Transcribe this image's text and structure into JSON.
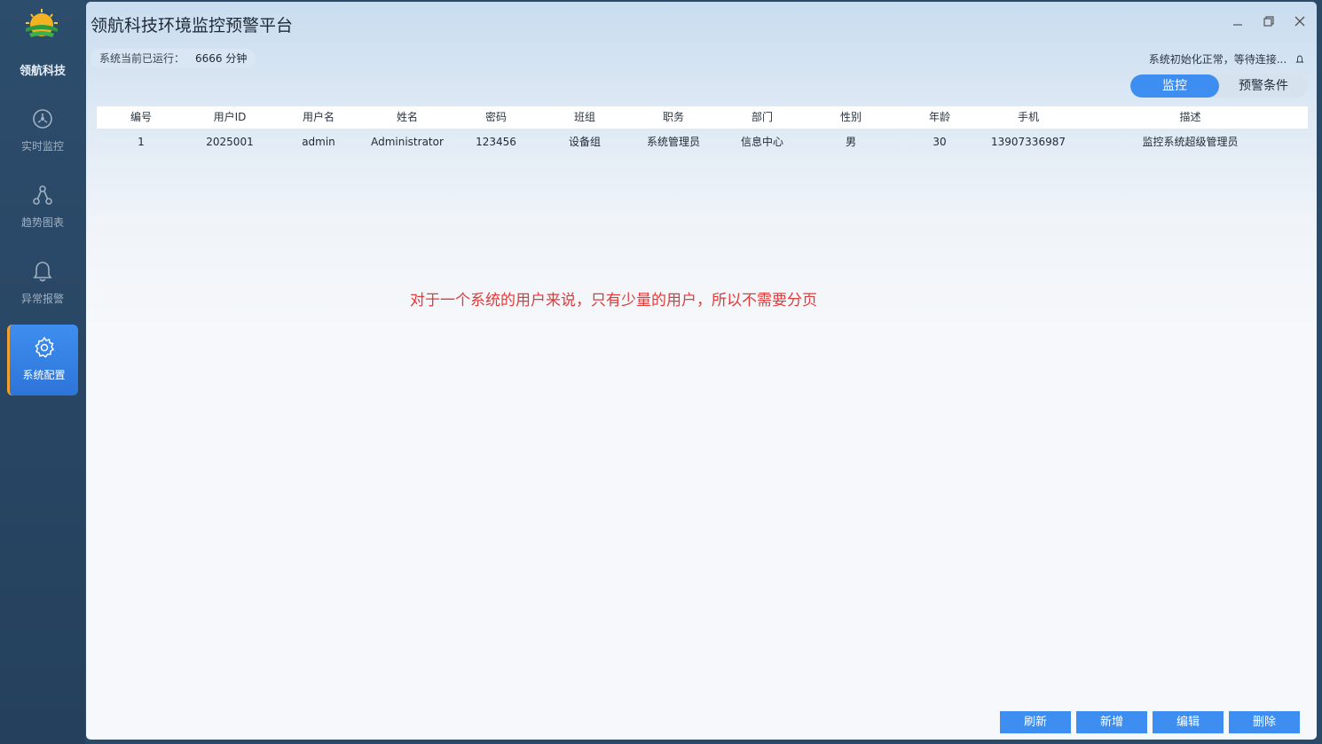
{
  "sidebar": {
    "brand": "领航科技",
    "items": [
      {
        "label": "实时监控",
        "icon": "monitor-icon"
      },
      {
        "label": "趋势图表",
        "icon": "chart-nodes-icon"
      },
      {
        "label": "异常报警",
        "icon": "bell-icon"
      },
      {
        "label": "系统配置",
        "icon": "gear-icon",
        "active": true
      }
    ]
  },
  "window": {
    "title": "领航科技环境监控预警平台"
  },
  "runtime": {
    "label": "系统当前已运行：",
    "value": "6666 分钟"
  },
  "status": {
    "text": "系统初始化正常，等待连接..."
  },
  "tabs": [
    {
      "label": "监控",
      "active": true
    },
    {
      "label": "预警条件",
      "active": false
    }
  ],
  "table": {
    "headers": [
      "编号",
      "用户ID",
      "用户名",
      "姓名",
      "密码",
      "班组",
      "职务",
      "部门",
      "性别",
      "年龄",
      "手机",
      "描述"
    ],
    "rows": [
      [
        "1",
        "2025001",
        "admin",
        "Administrator",
        "123456",
        "设备组",
        "系统管理员",
        "信息中心",
        "男",
        "30",
        "13907336987",
        "监控系统超级管理员"
      ]
    ]
  },
  "note": "对于一个系统的用户来说，只有少量的用户，所以不需要分页",
  "buttons": {
    "refresh": "刷新",
    "add": "新增",
    "edit": "编辑",
    "delete": "删除"
  },
  "colors": {
    "accent": "#3d8ef0",
    "sidebar": "#2b4a68",
    "note": "#e03a3a"
  }
}
